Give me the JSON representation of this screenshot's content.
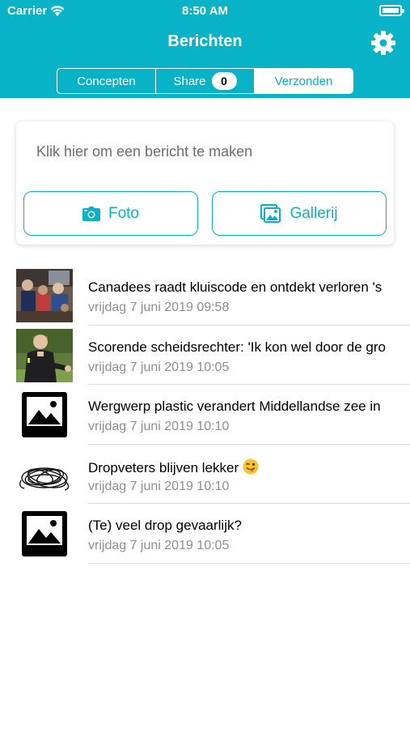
{
  "status_bar": {
    "carrier": "Carrier",
    "time": "8:50 AM",
    "battery_level": 1.0
  },
  "header": {
    "title": "Berichten",
    "settings_icon": "gear-icon",
    "tabs": [
      {
        "label": "Concepten"
      },
      {
        "label": "Share",
        "badge": "0"
      },
      {
        "label": "Verzonden",
        "selected": true
      }
    ]
  },
  "compose": {
    "placeholder": "Klik hier om een bericht te maken",
    "photo_button": {
      "label": "Foto",
      "icon": "camera-icon"
    },
    "gallery_button": {
      "label": "Gallerij",
      "icon": "gallery-icon"
    }
  },
  "messages": [
    {
      "title": "Canadees raadt kluiscode en ontdekt verloren 's",
      "date": "vrijdag 7 juni 2019 09:58",
      "thumbnail": "photo-crowd"
    },
    {
      "title": "Scorende scheidsrechter: 'Ik kon wel door de gro",
      "date": "vrijdag 7 juni 2019 10:05",
      "thumbnail": "photo-referee"
    },
    {
      "title": "Wergwerp plastic verandert Middellandse zee in",
      "date": "vrijdag 7 juni 2019 10:10",
      "thumbnail": "image-placeholder-icon"
    },
    {
      "title": "Dropveters blijven lekker",
      "emoji": "winking-tongue-emoji",
      "date": "vrijdag 7 juni 2019 10:10",
      "thumbnail": "photo-licorice"
    },
    {
      "title": "(Te) veel drop gevaarlijk?",
      "date": "vrijdag 7 juni 2019 10:05",
      "thumbnail": "image-placeholder-icon"
    }
  ],
  "colors": {
    "accent": "#09b3c7",
    "date_text": "#8e8e93",
    "separator": "#dcdcdc"
  }
}
